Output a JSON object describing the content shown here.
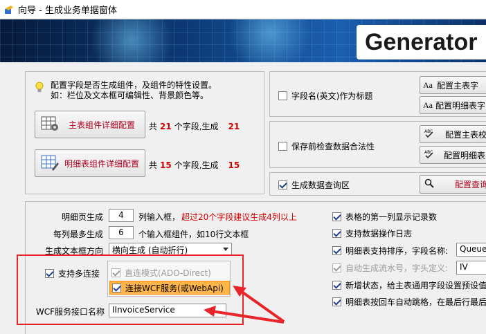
{
  "window": {
    "title": "向导 - 生成业务单据窗体"
  },
  "banner": {
    "title": "Generator"
  },
  "config_panel": {
    "info_line1": "配置字段是否生成组件，及组件的特性设置。",
    "info_line2": "如：栏位及文本框可编辑性、背景颜色等。",
    "master_btn_label": "主表组件详细配置",
    "master_count_prefix": "共",
    "master_field_count": "21",
    "master_count_mid": "个字段,生成",
    "master_gen_count": "21",
    "detail_btn_label": "明细表组件详细配置",
    "detail_count_prefix": "共",
    "detail_field_count": "15",
    "detail_count_mid": "个字段,生成",
    "detail_gen_count": "15"
  },
  "right_top": {
    "field_name_title": "字段名(英文)作为标题",
    "btn_master_config": "配置主表字",
    "btn_detail_config": "配置明细表字",
    "save_check": "保存前检查数据合法性",
    "btn_master_check": "配置主表校",
    "btn_detail_check": "配置明细表",
    "gen_query": "生成数据查询区",
    "btn_query": "配置查询"
  },
  "left_settings": {
    "detail_page_label": "明细页生成",
    "detail_page_value": "4",
    "detail_page_unit": "列输入框，",
    "detail_page_warning": "超过20个字段建议生成4列以上",
    "max_per_col_label": "每列最多生成",
    "max_per_col_value": "6",
    "max_per_col_unit": "个输入框组件，如10行文本框",
    "textbox_dir_label": "生成文本框方向",
    "textbox_dir_value": "横向生成 (自动折行)",
    "multi_conn_label": "支持多连接",
    "direct_mode_label": "直连模式(ADO-Direct)",
    "wcf_mode_label": "连接WCF服务(或WebApi)",
    "wcf_iface_label": "WCF服务接口名称",
    "wcf_iface_value": "IInvoiceService"
  },
  "right_settings": {
    "opt1": "表格的第一列显示记录数",
    "opt2": "支持数据操作日志",
    "opt3": "明细表支持排序，字段名称:",
    "opt3_value": "Queue",
    "opt4": "自动生成流水号，字头定义:",
    "opt4_value": "IV",
    "opt5": "新增状态，给主表通用字段设置预设值",
    "opt6": "明细表按回车自动跳格，在最后行最后"
  },
  "colors": {
    "accent_red": "#d00000",
    "highlight_red": "#e8262a",
    "banner_blue": "#0d3b78"
  }
}
